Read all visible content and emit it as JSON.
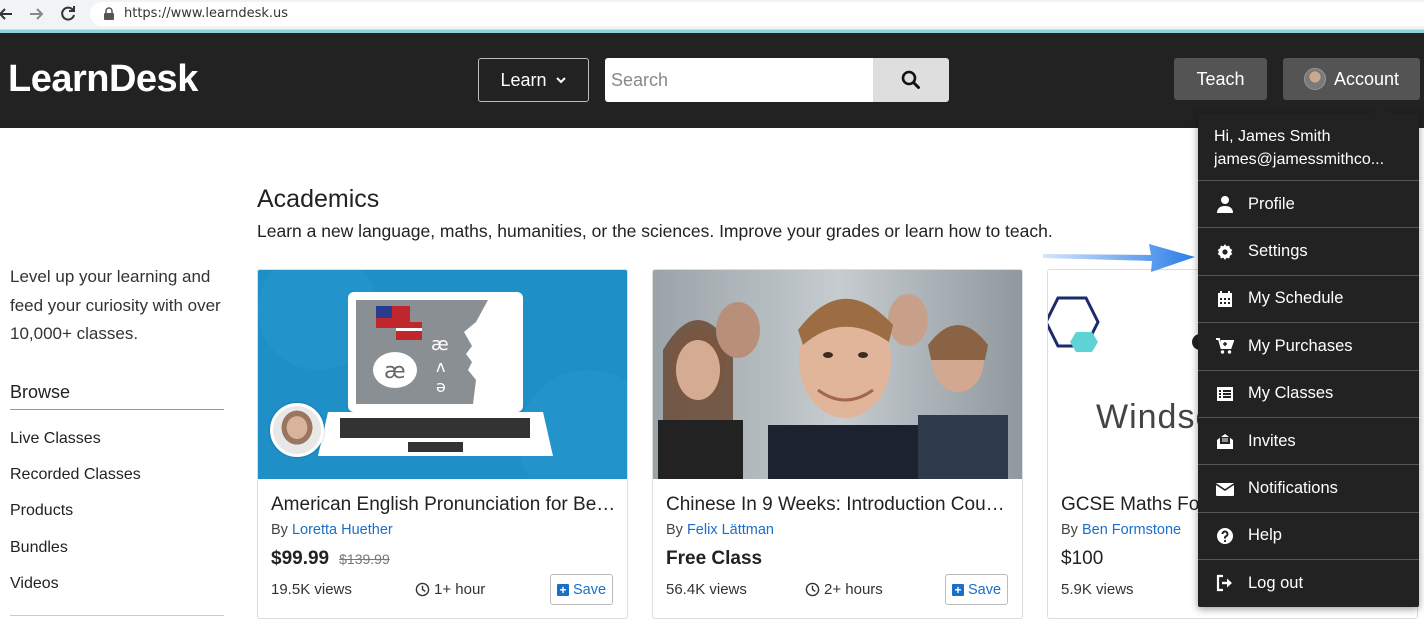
{
  "browser": {
    "url": "https://www.learndesk.us"
  },
  "header": {
    "logo": "LearnDesk",
    "learn_label": "Learn",
    "search_placeholder": "Search",
    "teach_label": "Teach",
    "account_label": "Account"
  },
  "sidebar": {
    "tagline": "Level up your learning and feed your curiosity with over 10,000+ classes.",
    "browse_heading": "Browse",
    "items": [
      "Live Classes",
      "Recorded Classes",
      "Products",
      "Bundles",
      "Videos"
    ]
  },
  "section": {
    "title": "Academics",
    "description": "Learn a new language, maths, humanities, or the sciences. Improve your grades or learn how to teach."
  },
  "cards": [
    {
      "title": "American English Pronunciation for Be…",
      "by": "By",
      "instructor": "Loretta Huether",
      "price": "$99.99",
      "old_price": "$139.99",
      "views": "19.5K views",
      "duration": "1+ hour",
      "save_label": "Save"
    },
    {
      "title": "Chinese In 9 Weeks: Introduction Cou…",
      "by": "By",
      "instructor": "Felix Lättman",
      "price": "Free Class",
      "views": "56.4K views",
      "duration": "2+ hours",
      "save_label": "Save"
    },
    {
      "title": "GCSE Maths Fo",
      "by": "By",
      "instructor": "Ben Formstone",
      "price": "$100",
      "views": "5.9K views",
      "image_text": "Windso"
    }
  ],
  "dropdown": {
    "greeting": "Hi, James Smith",
    "email": "james@jamessmithco...",
    "items": [
      {
        "label": "Profile",
        "icon": "user-icon"
      },
      {
        "label": "Settings",
        "icon": "gear-icon"
      },
      {
        "label": "My Schedule",
        "icon": "calendar-icon"
      },
      {
        "label": "My Purchases",
        "icon": "cart-icon"
      },
      {
        "label": "My Classes",
        "icon": "list-icon"
      },
      {
        "label": "Invites",
        "icon": "invite-icon"
      },
      {
        "label": "Notifications",
        "icon": "envelope-icon"
      },
      {
        "label": "Help",
        "icon": "question-icon"
      },
      {
        "label": "Log out",
        "icon": "logout-icon"
      }
    ]
  },
  "colors": {
    "header_bg": "#222222",
    "link_blue": "#1a6fc9",
    "arrow_blue": "#2b7ee8",
    "card1_bg": "#1e8fc7"
  }
}
